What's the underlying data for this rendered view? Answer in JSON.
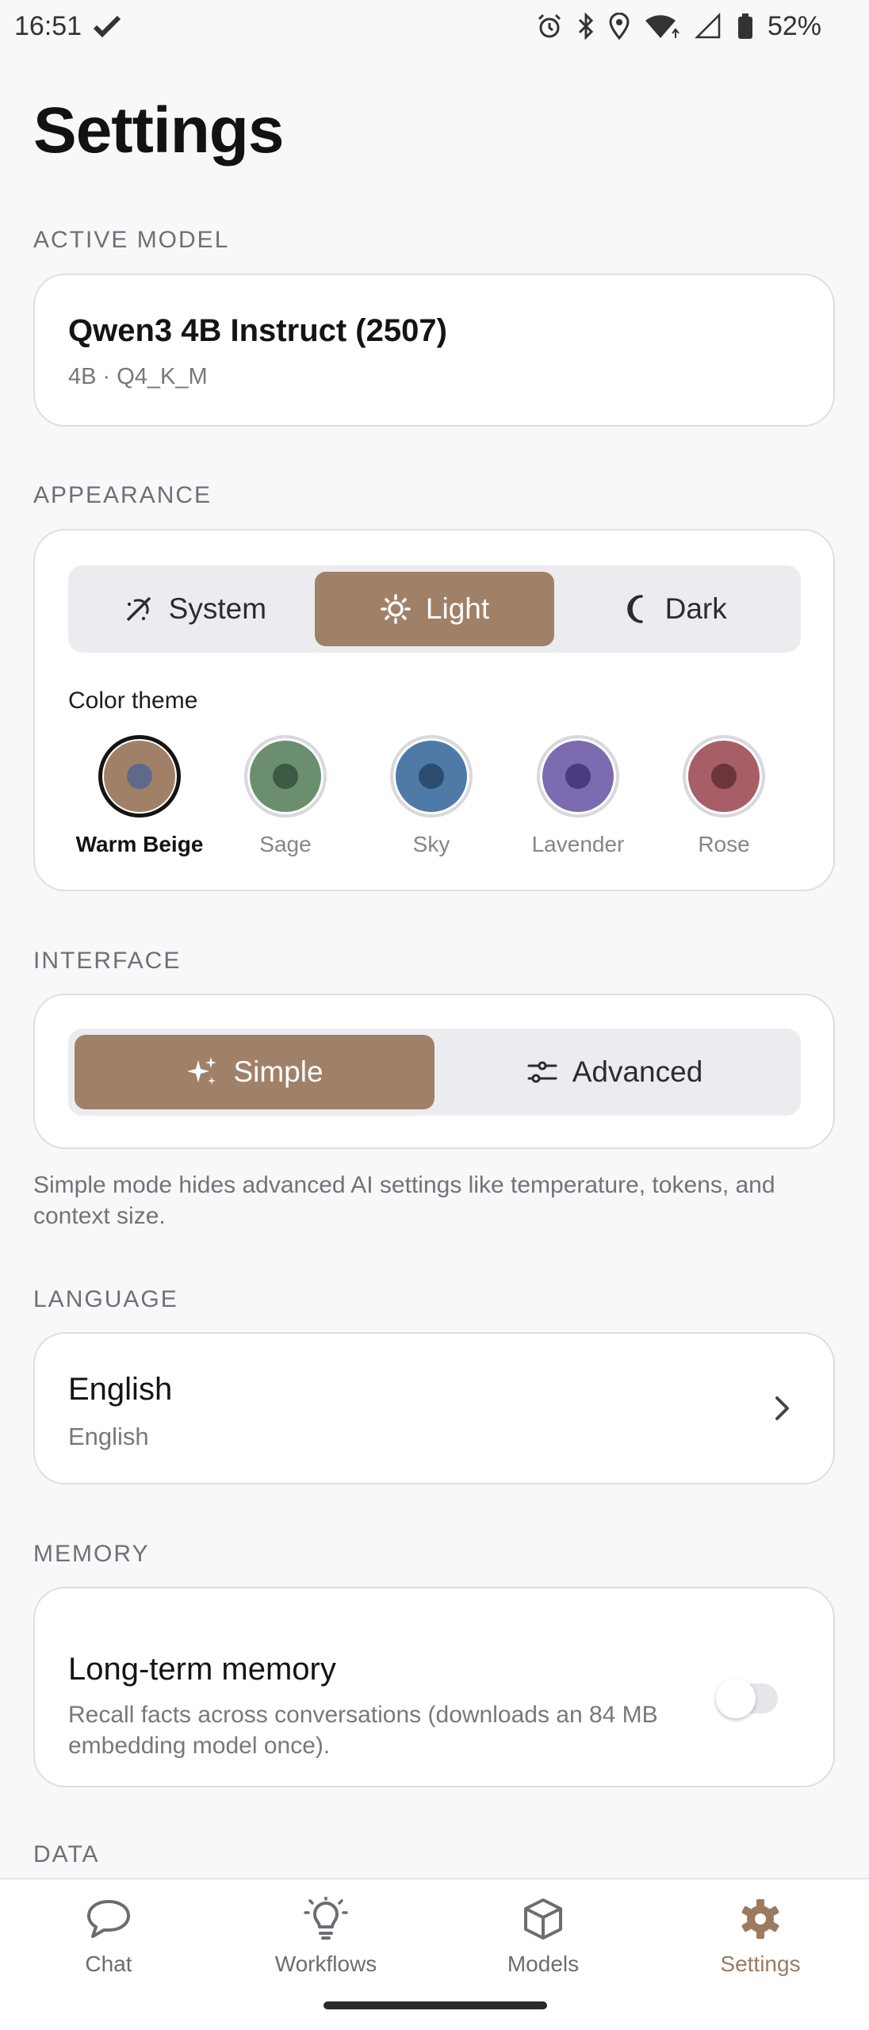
{
  "status_bar": {
    "time": "16:51",
    "battery": "52%"
  },
  "page": {
    "title": "Settings"
  },
  "active_model": {
    "section_label": "ACTIVE MODEL",
    "name": "Qwen3 4B Instruct (2507)",
    "details": "4B · Q4_K_M"
  },
  "appearance": {
    "section_label": "APPEARANCE",
    "modes": [
      {
        "label": "System",
        "icon": "auto-theme-icon",
        "selected": false
      },
      {
        "label": "Light",
        "icon": "sun-icon",
        "selected": true
      },
      {
        "label": "Dark",
        "icon": "moon-icon",
        "selected": false
      }
    ],
    "color_theme_label": "Color theme",
    "themes": [
      {
        "name": "Warm Beige",
        "color": "#a08168",
        "dot": "#5f6a8a",
        "selected": true
      },
      {
        "name": "Sage",
        "color": "#6b8f6e",
        "dot": "#3d5a45",
        "selected": false
      },
      {
        "name": "Sky",
        "color": "#4f7aa8",
        "dot": "#2c4c70",
        "selected": false
      },
      {
        "name": "Lavender",
        "color": "#7c6bb0",
        "dot": "#4a3a80",
        "selected": false
      },
      {
        "name": "Rose",
        "color": "#a85e66",
        "dot": "#6c353b",
        "selected": false
      }
    ]
  },
  "interface": {
    "section_label": "INTERFACE",
    "modes": [
      {
        "label": "Simple",
        "icon": "sparkles-icon",
        "selected": true
      },
      {
        "label": "Advanced",
        "icon": "sliders-icon",
        "selected": false
      }
    ],
    "note": "Simple mode hides advanced AI settings like temperature, tokens, and context size."
  },
  "language": {
    "section_label": "LANGUAGE",
    "title": "English",
    "subtitle": "English"
  },
  "memory": {
    "section_label": "MEMORY",
    "title": "Long-term memory",
    "description": "Recall facts across conversations (downloads an 84 MB embedding model once).",
    "enabled": false
  },
  "data": {
    "section_label": "DATA"
  },
  "bottom_nav": {
    "items": [
      {
        "label": "Chat",
        "icon": "chat-bubble-icon",
        "active": false
      },
      {
        "label": "Workflows",
        "icon": "lightbulb-icon",
        "active": false
      },
      {
        "label": "Models",
        "icon": "cube-icon",
        "active": false
      },
      {
        "label": "Settings",
        "icon": "gear-icon",
        "active": true
      }
    ]
  },
  "colors": {
    "accent": "#a08168",
    "active_nav": "#9c7a60",
    "background": "#f8f8fa"
  }
}
